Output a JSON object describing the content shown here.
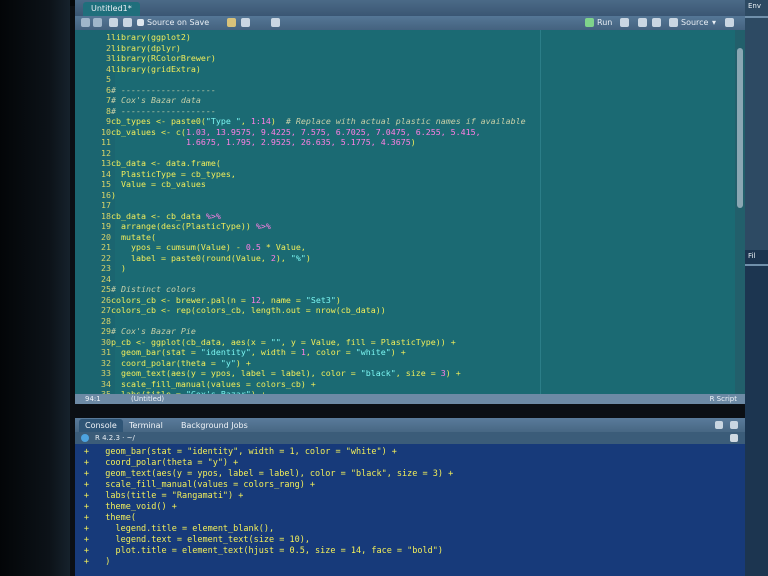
{
  "editor": {
    "tab_label": "Untitled1*",
    "toolbar": {
      "source_on_save": "Source on Save",
      "run": "Run",
      "source": "Source"
    },
    "status": {
      "position": "94:1",
      "file": "(Untitled)",
      "type": "R Script"
    },
    "lines": [
      {
        "n": "1",
        "segs": [
          {
            "t": "library(ggplot2)",
            "c": ""
          }
        ]
      },
      {
        "n": "2",
        "segs": [
          {
            "t": "library(dplyr)",
            "c": ""
          }
        ]
      },
      {
        "n": "3",
        "segs": [
          {
            "t": "library(RColorBrewer)",
            "c": ""
          }
        ]
      },
      {
        "n": "4",
        "segs": [
          {
            "t": "library(gridExtra)",
            "c": ""
          }
        ]
      },
      {
        "n": "5",
        "segs": [
          {
            "t": "",
            "c": ""
          }
        ]
      },
      {
        "n": "6",
        "segs": [
          {
            "t": "# -------------------",
            "c": "cm"
          }
        ]
      },
      {
        "n": "7",
        "segs": [
          {
            "t": "# Cox's Bazar data",
            "c": "cm"
          }
        ]
      },
      {
        "n": "8",
        "segs": [
          {
            "t": "# -------------------",
            "c": "cm"
          }
        ]
      },
      {
        "n": "9",
        "segs": [
          {
            "t": "cb_types <- paste0(",
            "c": ""
          },
          {
            "t": "\"Type \"",
            "c": "st"
          },
          {
            "t": ", ",
            "c": ""
          },
          {
            "t": "1:14",
            "c": "nm"
          },
          {
            "t": ")  ",
            "c": ""
          },
          {
            "t": "# Replace with actual plastic names if available",
            "c": "cm"
          }
        ]
      },
      {
        "n": "10",
        "segs": [
          {
            "t": "cb_values <- c(",
            "c": ""
          },
          {
            "t": "1.03, 13.9575, 9.4225, 7.575, 6.7025, 7.0475, 6.255, 5.415,",
            "c": "nm"
          }
        ]
      },
      {
        "n": "11",
        "segs": [
          {
            "t": "               ",
            "c": ""
          },
          {
            "t": "1.6675, 1.795, 2.9525, 26.635, 5.1775, 4.3675",
            "c": "nm"
          },
          {
            "t": ")",
            "c": ""
          }
        ]
      },
      {
        "n": "12",
        "segs": [
          {
            "t": "",
            "c": ""
          }
        ]
      },
      {
        "n": "13",
        "segs": [
          {
            "t": "cb_data <- data.frame(",
            "c": ""
          }
        ]
      },
      {
        "n": "14",
        "segs": [
          {
            "t": "  PlasticType = cb_types,",
            "c": ""
          }
        ]
      },
      {
        "n": "15",
        "segs": [
          {
            "t": "  Value = cb_values",
            "c": ""
          }
        ]
      },
      {
        "n": "16",
        "segs": [
          {
            "t": ")",
            "c": ""
          }
        ]
      },
      {
        "n": "17",
        "segs": [
          {
            "t": "",
            "c": ""
          }
        ]
      },
      {
        "n": "18",
        "segs": [
          {
            "t": "cb_data <- cb_data ",
            "c": ""
          },
          {
            "t": "%>%",
            "c": "op"
          }
        ]
      },
      {
        "n": "19",
        "segs": [
          {
            "t": "  arrange(desc(PlasticType)) ",
            "c": ""
          },
          {
            "t": "%>%",
            "c": "op"
          }
        ]
      },
      {
        "n": "20",
        "segs": [
          {
            "t": "  mutate(",
            "c": ""
          }
        ]
      },
      {
        "n": "21",
        "segs": [
          {
            "t": "    ypos = cumsum(Value) - ",
            "c": ""
          },
          {
            "t": "0.5",
            "c": "nm"
          },
          {
            "t": " * Value,",
            "c": ""
          }
        ]
      },
      {
        "n": "22",
        "segs": [
          {
            "t": "    label = paste0(round(Value, ",
            "c": ""
          },
          {
            "t": "2",
            "c": "nm"
          },
          {
            "t": "), ",
            "c": ""
          },
          {
            "t": "\"%\"",
            "c": "st"
          },
          {
            "t": ")",
            "c": ""
          }
        ]
      },
      {
        "n": "23",
        "segs": [
          {
            "t": "  )",
            "c": ""
          }
        ]
      },
      {
        "n": "24",
        "segs": [
          {
            "t": "",
            "c": ""
          }
        ]
      },
      {
        "n": "25",
        "segs": [
          {
            "t": "# Distinct colors",
            "c": "cm"
          }
        ]
      },
      {
        "n": "26",
        "segs": [
          {
            "t": "colors_cb <- brewer.pal(n = ",
            "c": ""
          },
          {
            "t": "12",
            "c": "nm"
          },
          {
            "t": ", name = ",
            "c": ""
          },
          {
            "t": "\"Set3\"",
            "c": "st"
          },
          {
            "t": ")",
            "c": ""
          }
        ]
      },
      {
        "n": "27",
        "segs": [
          {
            "t": "colors_cb <- rep(colors_cb, length.out = nrow(cb_data))",
            "c": ""
          }
        ]
      },
      {
        "n": "28",
        "segs": [
          {
            "t": "",
            "c": ""
          }
        ]
      },
      {
        "n": "29",
        "segs": [
          {
            "t": "# Cox's Bazar Pie",
            "c": "cm"
          }
        ]
      },
      {
        "n": "30",
        "segs": [
          {
            "t": "p_cb <- ggplot(cb_data, aes(x = ",
            "c": ""
          },
          {
            "t": "\"\"",
            "c": "st"
          },
          {
            "t": ", y = Value, fill = PlasticType)) +",
            "c": ""
          }
        ]
      },
      {
        "n": "31",
        "segs": [
          {
            "t": "  geom_bar(stat = ",
            "c": ""
          },
          {
            "t": "\"identity\"",
            "c": "st"
          },
          {
            "t": ", width = ",
            "c": ""
          },
          {
            "t": "1",
            "c": "nm"
          },
          {
            "t": ", color = ",
            "c": ""
          },
          {
            "t": "\"white\"",
            "c": "st"
          },
          {
            "t": ") +",
            "c": ""
          }
        ]
      },
      {
        "n": "32",
        "segs": [
          {
            "t": "  coord_polar(theta = ",
            "c": ""
          },
          {
            "t": "\"y\"",
            "c": "st"
          },
          {
            "t": ") +",
            "c": ""
          }
        ]
      },
      {
        "n": "33",
        "segs": [
          {
            "t": "  geom_text(aes(y = ypos, label = label), color = ",
            "c": ""
          },
          {
            "t": "\"black\"",
            "c": "st"
          },
          {
            "t": ", size = ",
            "c": ""
          },
          {
            "t": "3",
            "c": "nm"
          },
          {
            "t": ") +",
            "c": ""
          }
        ]
      },
      {
        "n": "34",
        "segs": [
          {
            "t": "  scale_fill_manual(values = colors_cb) +",
            "c": ""
          }
        ]
      },
      {
        "n": "35",
        "segs": [
          {
            "t": "  labs(title = ",
            "c": ""
          },
          {
            "t": "\"Cox's Bazar\"",
            "c": "st"
          },
          {
            "t": ") +",
            "c": ""
          }
        ]
      }
    ]
  },
  "console": {
    "tabs": [
      "Console",
      "Terminal",
      "Background Jobs"
    ],
    "r_version": "R 4.2.3 · ~/",
    "lines": [
      {
        "p": "+",
        "t": "  geom_bar(stat = \"identity\", width = 1, color = \"white\") +"
      },
      {
        "p": "+",
        "t": "  coord_polar(theta = \"y\") +"
      },
      {
        "p": "+",
        "t": "  geom_text(aes(y = ypos, label = label), color = \"black\", size = 3) +"
      },
      {
        "p": "+",
        "t": "  scale_fill_manual(values = colors_rang) +"
      },
      {
        "p": "+",
        "t": "  labs(title = \"Rangamati\") +"
      },
      {
        "p": "+",
        "t": "  theme_void() +"
      },
      {
        "p": "+",
        "t": "  theme("
      },
      {
        "p": "+",
        "t": "    legend.title = element_blank(),"
      },
      {
        "p": "+",
        "t": "    legend.text = element_text(size = 10),"
      },
      {
        "p": "+",
        "t": "    plot.title = element_text(hjust = 0.5, size = 14, face = \"bold\")"
      },
      {
        "p": "+",
        "t": "  )"
      }
    ]
  },
  "right_pane": {
    "top_label": "Env",
    "bottom_label": "Fil"
  }
}
